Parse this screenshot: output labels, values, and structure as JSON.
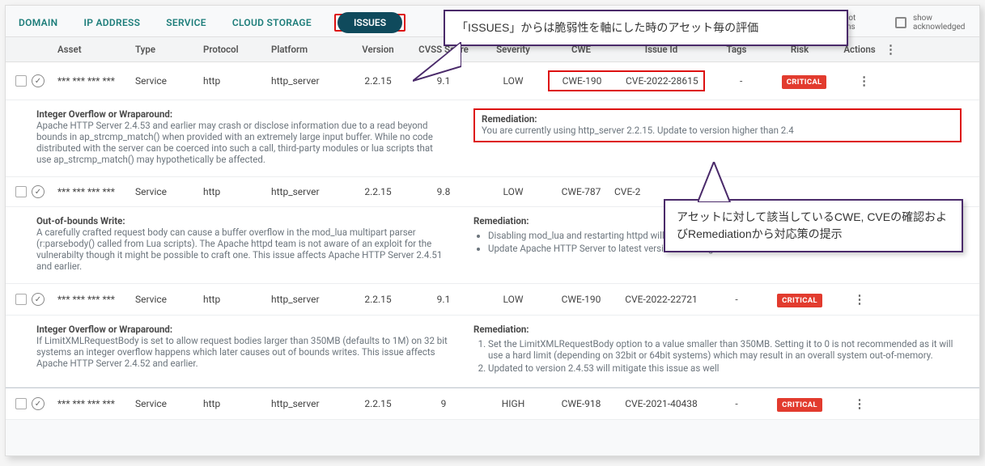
{
  "tabs": {
    "items": [
      "DOMAIN",
      "IP ADDRESS",
      "SERVICE",
      "CLOUD STORAGE",
      "ISSUES"
    ],
    "active": "ISSUES"
  },
  "filters": {
    "root": "hide root domains",
    "ack": "show acknowledged"
  },
  "columns": {
    "asset": "Asset",
    "type": "Type",
    "protocol": "Protocol",
    "platform": "Platform",
    "version": "Version",
    "cvss": "CVSS Score",
    "severity": "Severity",
    "cwe": "CWE",
    "issue": "Issue Id",
    "tags": "Tags",
    "risk": "Risk",
    "actions": "Actions"
  },
  "rows": [
    {
      "asset": "*** *** *** ***",
      "type": "Service",
      "protocol": "http",
      "platform": "http_server",
      "version": "2.2.15",
      "cvss": "9.1",
      "severity": "LOW",
      "cwe": "CWE-190",
      "issue": "CVE-2022-28615",
      "tags": "-",
      "risk": "CRITICAL",
      "detail": {
        "title": "Integer Overflow or Wraparound:",
        "body": "Apache HTTP Server 2.4.53 and earlier may crash or disclose information due to a read beyond bounds in ap_strcmp_match() when provided with an extremely large input buffer. While no code distributed with the server can be coerced into such a call, third-party modules or lua scripts that use ap_strcmp_match() may hypothetically be affected.",
        "rem_title": "Remediation:",
        "rem_body": "You are currently using http_server 2.2.15. Update to version higher than 2.4"
      }
    },
    {
      "asset": "*** *** *** ***",
      "type": "Service",
      "protocol": "http",
      "platform": "http_server",
      "version": "2.2.15",
      "cvss": "9.8",
      "severity": "LOW",
      "cwe": "CWE-787",
      "issue": "CVE-2",
      "tags": "",
      "risk": "",
      "detail": {
        "title": "Out-of-bounds Write:",
        "body": "A carefully crafted request body can cause a buffer overflow in the mod_lua multipart parser (r:parsebody() called from Lua scripts). The Apache httpd team is not aware of an exploit for the vulnerabilty though it might be possible to craft one. This issue affects Apache HTTP Server 2.4.51 and earlier.",
        "rem_title": "Remediation:",
        "rem_list": [
          "Disabling mod_lua and restarting httpd will mitigate this flaw",
          "Update Apache HTTP Server to latest version will mitigate this issue"
        ]
      }
    },
    {
      "asset": "*** *** *** ***",
      "type": "Service",
      "protocol": "http",
      "platform": "http_server",
      "version": "2.2.15",
      "cvss": "9.1",
      "severity": "LOW",
      "cwe": "CWE-190",
      "issue": "CVE-2022-22721",
      "tags": "-",
      "risk": "CRITICAL",
      "detail": {
        "title": "Integer Overflow or Wraparound:",
        "body": "If LimitXMLRequestBody is set to allow request bodies larger than 350MB (defaults to 1M) on 32 bit systems an integer overflow happens which later causes out of bounds writes. This issue affects Apache HTTP Server 2.4.52 and earlier.",
        "rem_title": "Remediation:",
        "rem_ol": [
          "Set the LimitXMLRequestBody option to a value smaller than 350MB. Setting it to 0 is not recommended as it will use a hard limit (depending on 32bit or 64bit systems) which may result in an overall system out-of-memory.",
          "Updated to version 2.4.53 will mitigate this issue as well"
        ]
      }
    },
    {
      "asset": "*** *** *** ***",
      "type": "Service",
      "protocol": "http",
      "platform": "http_server",
      "version": "2.2.15",
      "cvss": "9",
      "severity": "HIGH",
      "cwe": "CWE-918",
      "issue": "CVE-2021-40438",
      "tags": "-",
      "risk": "CRITICAL"
    }
  ],
  "callouts": {
    "c1": "「ISSUES」からは脆弱性を軸にした時のアセット毎の評価",
    "c2": "アセットに対して該当しているCWE, CVEの確認およびRemediationから対応策の提示"
  }
}
